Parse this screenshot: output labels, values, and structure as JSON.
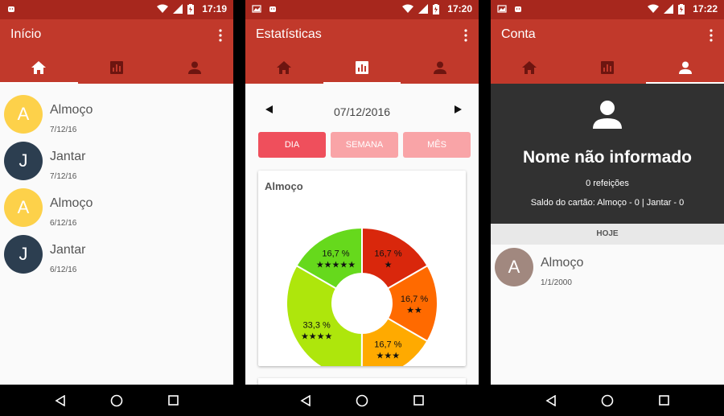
{
  "screens": [
    {
      "status_time": "17:19",
      "title": "Início",
      "active_tab": 0,
      "items": [
        {
          "letter": "A",
          "title": "Almoço",
          "date": "7/12/16",
          "color": "#fdd14a"
        },
        {
          "letter": "J",
          "title": "Jantar",
          "date": "7/12/16",
          "color": "#2c3e50"
        },
        {
          "letter": "A",
          "title": "Almoço",
          "date": "6/12/16",
          "color": "#fdd14a"
        },
        {
          "letter": "J",
          "title": "Jantar",
          "date": "6/12/16",
          "color": "#2c3e50"
        }
      ]
    },
    {
      "status_time": "17:20",
      "title": "Estatísticas",
      "active_tab": 1,
      "date": "07/12/2016",
      "segments": [
        {
          "label": "DIA",
          "active": true
        },
        {
          "label": "SEMANA",
          "active": false
        },
        {
          "label": "MÊS",
          "active": false
        }
      ],
      "card_title": "Almoço"
    },
    {
      "status_time": "17:22",
      "title": "Conta",
      "active_tab": 2,
      "profile_name": "Nome não informado",
      "meals": "0 refeições",
      "balance": "Saldo do cartão: Almoço - 0 | Jantar - 0",
      "section": "HOJE",
      "items": [
        {
          "letter": "A",
          "title": "Almoço",
          "date": "1/1/2000",
          "color": "#a1887f"
        }
      ]
    }
  ],
  "chart_data": {
    "type": "pie",
    "title": "Almoço",
    "slices": [
      {
        "label": "16,7 %",
        "stars": "★",
        "value": 16.7,
        "color": "#d9270c"
      },
      {
        "label": "16,7 %",
        "stars": "★★",
        "value": 16.7,
        "color": "#ff6a00"
      },
      {
        "label": "16,7 %",
        "stars": "★★★",
        "value": 16.7,
        "color": "#ffaa00"
      },
      {
        "label": "33,3 %",
        "stars": "★★★★",
        "value": 33.3,
        "color": "#aee60c"
      },
      {
        "label": "16,7 %",
        "stars": "★★★★★",
        "value": 16.7,
        "color": "#66d91c"
      }
    ]
  }
}
